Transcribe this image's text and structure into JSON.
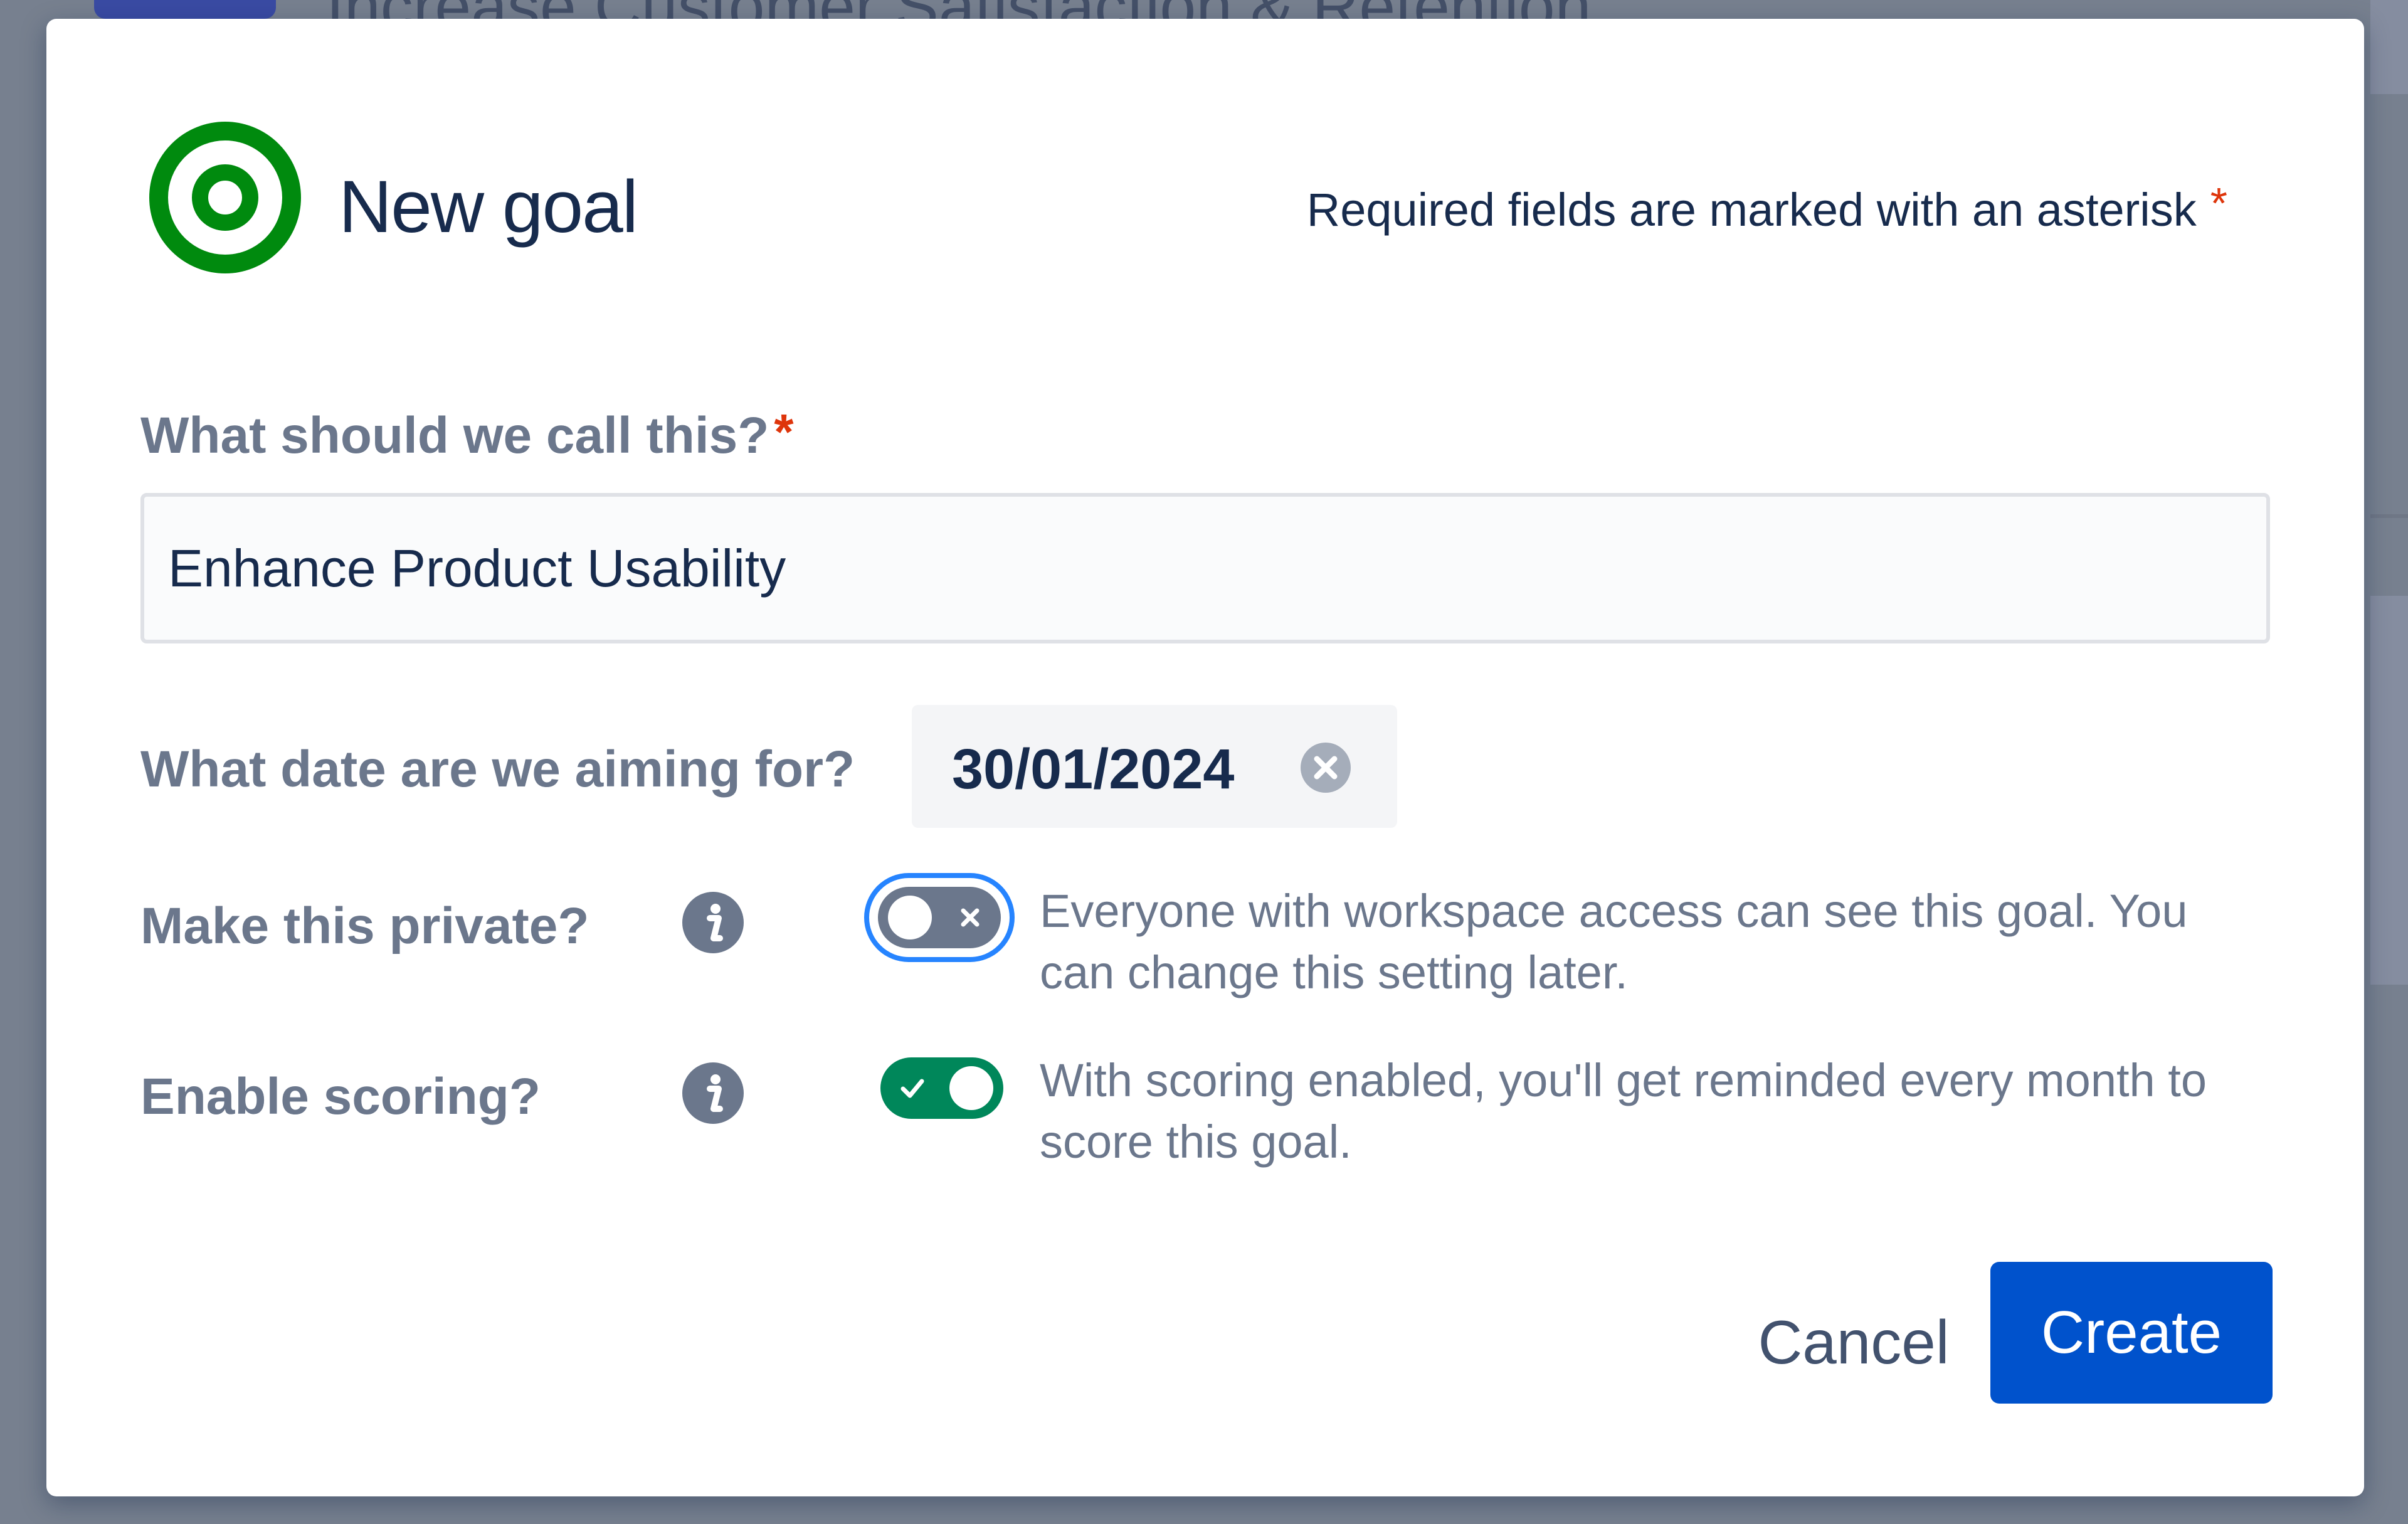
{
  "background": {
    "page_title": "Increase Customer Satisfaction & Retention"
  },
  "modal": {
    "title": "New goal",
    "required_note": "Required fields are marked with an asterisk",
    "required_marker": "*",
    "name_field": {
      "label": "What should we call this?",
      "value": "Enhance Product Usability"
    },
    "date_field": {
      "label": "What date are we aiming for?",
      "value": "30/01/2024"
    },
    "private_field": {
      "label": "Make this private?",
      "enabled": false,
      "helper": "Everyone with workspace access can see this goal. You can change this setting later."
    },
    "scoring_field": {
      "label": "Enable scoring?",
      "enabled": true,
      "helper": "With scoring enabled, you'll get reminded every month to score this goal."
    },
    "cancel_label": "Cancel",
    "create_label": "Create"
  },
  "colors": {
    "brand_blue": "#0052cc",
    "goal_icon_green": "#008a0e",
    "toggle_on": "#00875a",
    "toggle_off": "#6b778c",
    "required_red": "#de350b",
    "text_dark": "#172b4d",
    "text_subtle": "#6b778c"
  },
  "icons": {
    "goal": "target-icon",
    "info": "info-icon",
    "clear": "clear-circle-icon",
    "toggle_off_mark": "x-icon",
    "toggle_on_mark": "check-icon"
  }
}
